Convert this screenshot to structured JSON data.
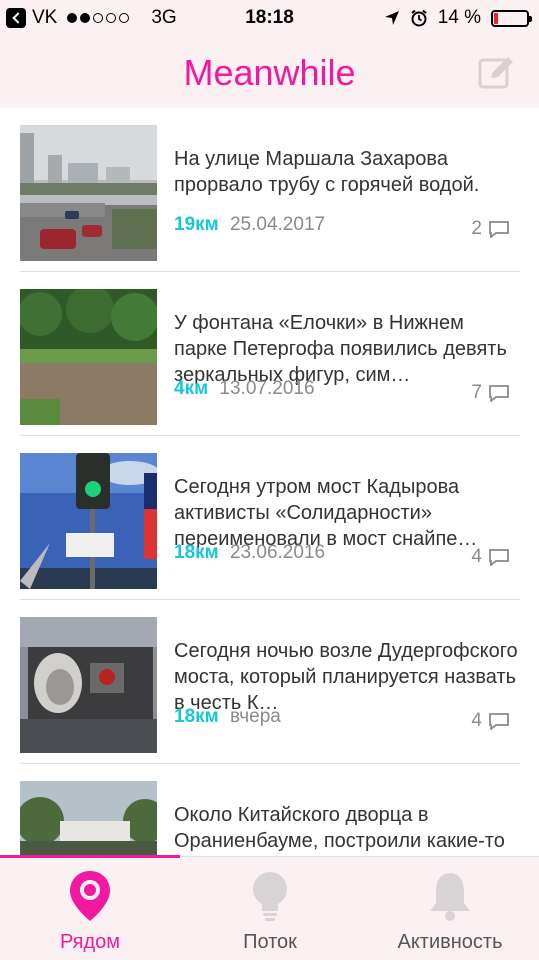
{
  "status_bar": {
    "carrier": "VK",
    "network": "3G",
    "time": "18:18",
    "battery": "14 %",
    "battery_level": 0.14,
    "icons": [
      "back-to-app-icon",
      "signal-dots-icon",
      "location-arrow-icon",
      "alarm-clock-icon",
      "battery-icon"
    ]
  },
  "header": {
    "title": "Meanwhile",
    "edit_icon": "compose-icon"
  },
  "colors": {
    "accent": "#f0199f",
    "distance": "#18c5d9",
    "muted": "#8a8a8a",
    "bar_bg": "#fcf1f2"
  },
  "feed": [
    {
      "title": "На улице Маршала Захарова прорвало трубу с горячей водой.",
      "distance": "19км",
      "date": "25.04.2017",
      "comments": "2"
    },
    {
      "title": "У фонтана «Елочки» в Нижнем парке Петергофа появились девять зеркальных фигур, сим…",
      "distance": "4км",
      "date": "13.07.2016",
      "comments": "7"
    },
    {
      "title": "Сегодня утром мост Кадырова активисты «Солидарности» переименовали в мост снайпе…",
      "distance": "18км",
      "date": "23.06.2016",
      "comments": "4"
    },
    {
      "title": "Сегодня ночью возле Дудергофского моста, который планируется назвать в честь К…",
      "distance": "18км",
      "date": "вчера",
      "comments": "4"
    },
    {
      "title": "Около Китайского дворца в Ораниенбауме, построили какие-то шатры.Чья-то частна",
      "distance": "",
      "date": "",
      "comments": ""
    }
  ],
  "tabs": [
    {
      "label": "Рядом",
      "icon": "location-pin-icon",
      "active": true
    },
    {
      "label": "Поток",
      "icon": "lightbulb-icon",
      "active": false
    },
    {
      "label": "Активность",
      "icon": "bell-icon",
      "active": false
    }
  ]
}
